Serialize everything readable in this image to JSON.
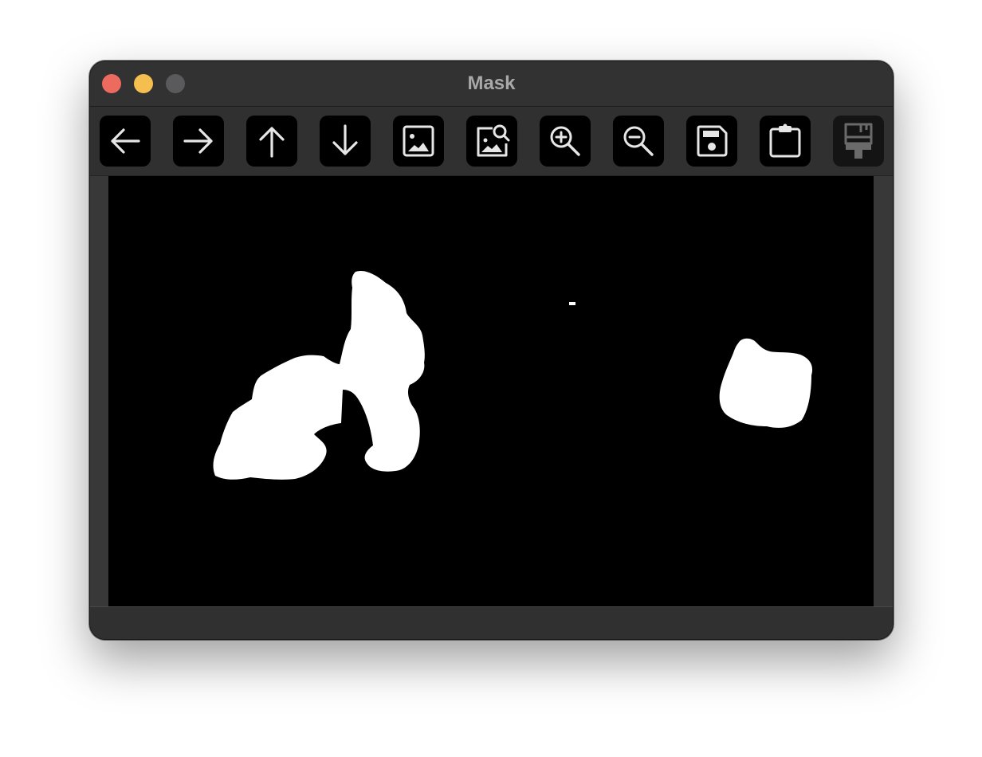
{
  "window": {
    "title": "Mask"
  },
  "toolbar": {
    "buttons": [
      {
        "name": "back-button",
        "icon": "arrow-left-icon",
        "enabled": true
      },
      {
        "name": "forward-button",
        "icon": "arrow-right-icon",
        "enabled": true
      },
      {
        "name": "up-button",
        "icon": "arrow-up-icon",
        "enabled": true
      },
      {
        "name": "down-button",
        "icon": "arrow-down-icon",
        "enabled": true
      },
      {
        "name": "image-button",
        "icon": "image-icon",
        "enabled": true
      },
      {
        "name": "image-search-button",
        "icon": "image-search-icon",
        "enabled": true
      },
      {
        "name": "zoom-in-button",
        "icon": "zoom-in-icon",
        "enabled": true
      },
      {
        "name": "zoom-out-button",
        "icon": "zoom-out-icon",
        "enabled": true
      },
      {
        "name": "save-button",
        "icon": "save-icon",
        "enabled": true
      },
      {
        "name": "clipboard-button",
        "icon": "clipboard-icon",
        "enabled": true
      },
      {
        "name": "paint-brush-button",
        "icon": "paint-brush-icon",
        "enabled": false
      }
    ]
  },
  "colors": {
    "close": "#ed6a5e",
    "minimize": "#f5bf4f",
    "zoom": "#5a5a5c",
    "icon": "#e6e6e6",
    "icon_disabled": "#6a6a6a",
    "mask_foreground": "#ffffff",
    "mask_background": "#000000"
  }
}
